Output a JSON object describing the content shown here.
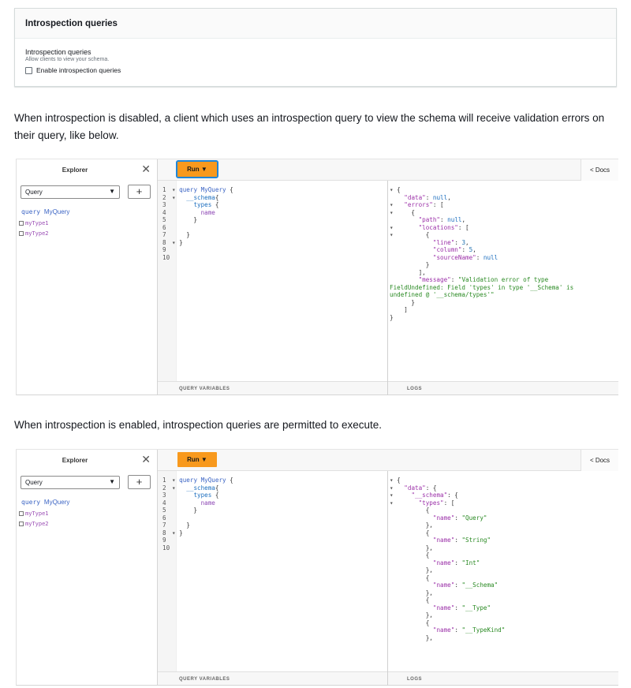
{
  "settings": {
    "header": "Introspection queries",
    "field_label": "Introspection queries",
    "field_desc": "Allow clients to view your schema.",
    "checkbox_label": "Enable introspection queries"
  },
  "para1": "When introspection is disabled, a client which uses an introspection query to view the schema will receive validation errors on their query, like below.",
  "para2": "When introspection is enabled, introspection queries are permitted to execute.",
  "graphiql": {
    "explorer_title": "Explorer",
    "close_icon": "close-icon",
    "operation_select": "Query",
    "add_label": "+",
    "query_keyword": "query",
    "query_name": "MyQuery",
    "types": [
      "myType1",
      "myType2"
    ],
    "run_label": "Run ▼",
    "docs_label": "< Docs",
    "query_variables": "QUERY VARIABLES",
    "logs": "LOGS",
    "run_color": "#f8991d"
  }
}
